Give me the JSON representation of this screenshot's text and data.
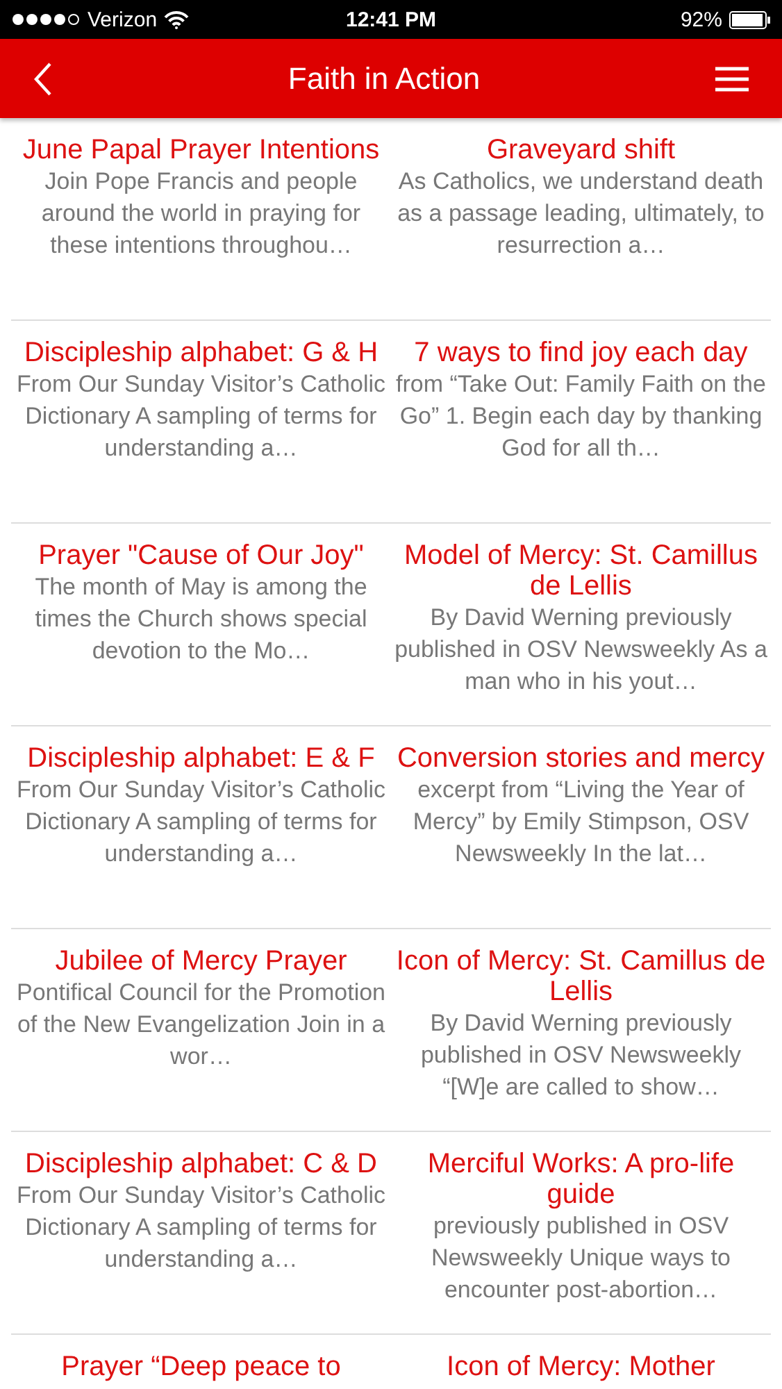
{
  "status_bar": {
    "carrier": "Verizon",
    "time": "12:41 PM",
    "battery": "92%"
  },
  "nav_bar": {
    "title": "Faith in Action"
  },
  "articles": [
    {
      "title": "June Papal Prayer Intentions",
      "excerpt": "Join Pope Francis and people around the world in praying for these intentions throughou…"
    },
    {
      "title": "Graveyard shift",
      "excerpt": "As Catholics, we understand death as a passage leading, ultimately, to resurrection a…"
    },
    {
      "title": "Discipleship alphabet: G & H",
      "excerpt": "From Our Sunday Visitor’s Catholic Dictionary A sampling of terms for understanding a…"
    },
    {
      "title": "7 ways to find joy each day",
      "excerpt": "from “Take Out: Family Faith on the Go” 1. Begin each day by thanking God for all th…"
    },
    {
      "title": "Prayer \"Cause of Our Joy\"",
      "excerpt": "The month of May is among the times the Church shows special devotion to the Mo…"
    },
    {
      "title": "Model of Mercy: St. Camillus de Lellis",
      "excerpt": "By David Werning previously published in OSV Newsweekly As a man who in his yout…"
    },
    {
      "title": "Discipleship alphabet: E & F",
      "excerpt": "From Our Sunday Visitor’s Catholic Dictionary A sampling of terms for understanding a…"
    },
    {
      "title": "Conversion stories and mercy",
      "excerpt": "excerpt from “Living the Year of Mercy” by Emily Stimpson, OSV Newsweekly In the lat…"
    },
    {
      "title": "Jubilee of Mercy Prayer",
      "excerpt": "Pontifical Council for the Promotion of the New Evangelization Join in a wor…"
    },
    {
      "title": "Icon of Mercy: St. Camillus de Lellis",
      "excerpt": "By David Werning previously published in OSV Newsweekly “[W]e are called to show…"
    },
    {
      "title": "Discipleship alphabet: C & D",
      "excerpt": "From Our Sunday Visitor’s Catholic Dictionary A sampling of terms for understanding a…"
    },
    {
      "title": "Merciful Works: A pro-life guide",
      "excerpt": "previously published in OSV Newsweekly Unique ways to encounter post-abortion…"
    },
    {
      "title": "Prayer “Deep peace to"
    },
    {
      "title": "Icon of Mercy: Mother"
    }
  ]
}
